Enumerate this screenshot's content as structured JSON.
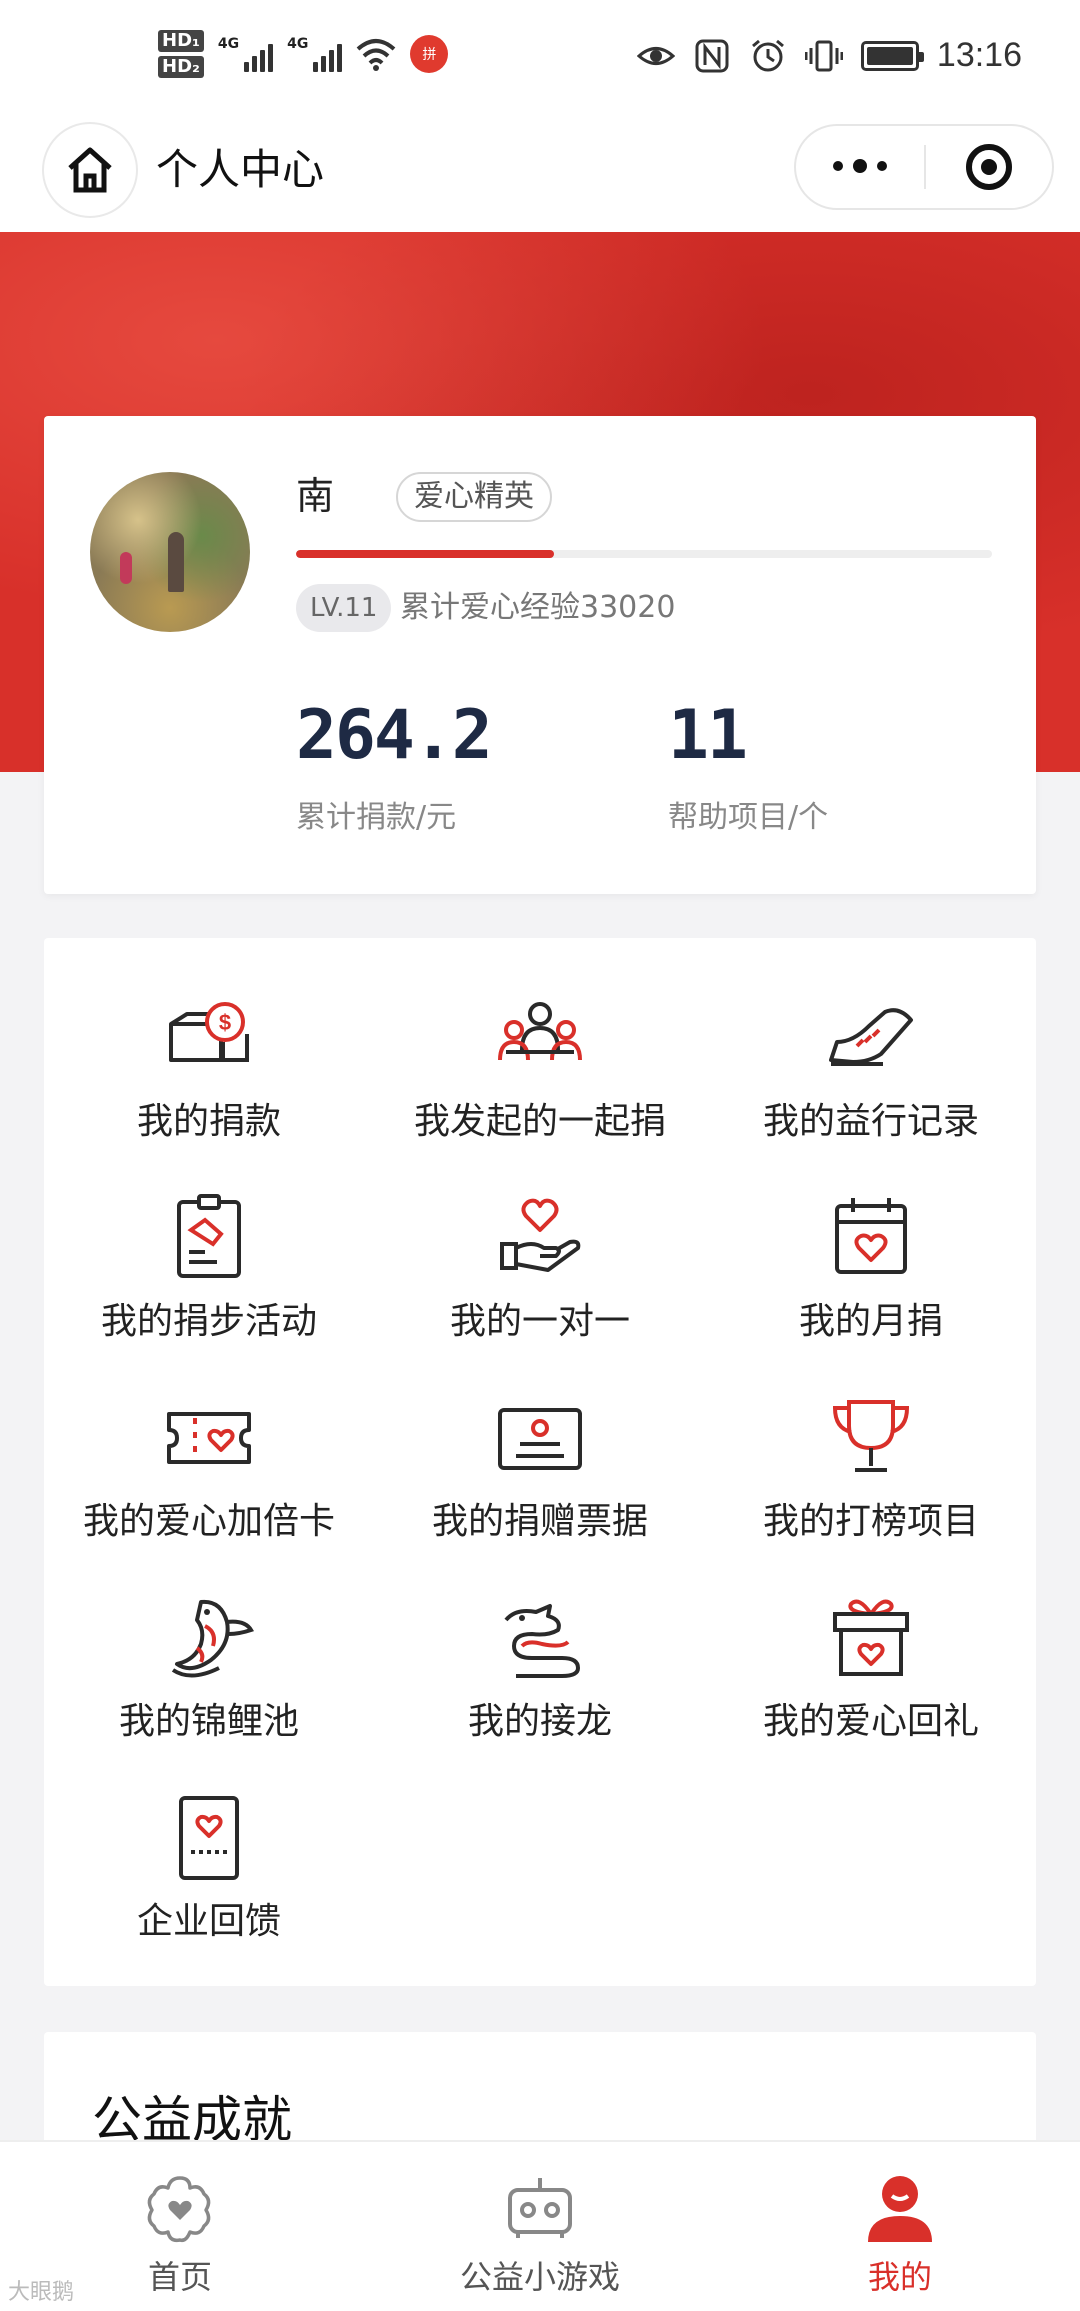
{
  "status_bar": {
    "hd1": "HD₁",
    "hd2": "HD₂",
    "net1": "4G",
    "net2": "4G",
    "time": "13:16",
    "app_dot": "拼"
  },
  "nav": {
    "title": "个人中心"
  },
  "profile": {
    "username": "南",
    "badge": "爱心精英",
    "level": "LV.11",
    "experience": "累计爱心经验33020",
    "level_progress": 0.37,
    "donation_total": "264.2",
    "donation_label": "累计捐款/元",
    "projects_count": "11",
    "projects_label": "帮助项目/个"
  },
  "menu": [
    {
      "label": "我的捐款",
      "icon": "donation-box-icon"
    },
    {
      "label": "我发起的一起捐",
      "icon": "group-people-icon"
    },
    {
      "label": "我的益行记录",
      "icon": "sneaker-icon"
    },
    {
      "label": "我的捐步活动",
      "icon": "clipboard-shoe-icon"
    },
    {
      "label": "我的一对一",
      "icon": "hand-heart-icon"
    },
    {
      "label": "我的月捐",
      "icon": "calendar-heart-icon"
    },
    {
      "label": "我的爱心加倍卡",
      "icon": "ticket-heart-icon"
    },
    {
      "label": "我的捐赠票据",
      "icon": "certificate-icon"
    },
    {
      "label": "我的打榜项目",
      "icon": "trophy-icon"
    },
    {
      "label": "我的锦鲤池",
      "icon": "koi-fish-icon"
    },
    {
      "label": "我的接龙",
      "icon": "dragon-icon"
    },
    {
      "label": "我的爱心回礼",
      "icon": "gift-box-icon"
    },
    {
      "label": "企业回馈",
      "icon": "card-heart-icon"
    }
  ],
  "achievements": {
    "title": "公益成就"
  },
  "tabbar": {
    "tabs": [
      {
        "label": "首页",
        "icon": "flower-heart-icon",
        "active": false
      },
      {
        "label": "公益小游戏",
        "icon": "game-controller-icon",
        "active": false
      },
      {
        "label": "我的",
        "icon": "user-icon",
        "active": true
      }
    ]
  },
  "watermark": "大眼鹅",
  "colors": {
    "accent": "#d9302a",
    "navy": "#1e2a44",
    "icon_dark": "#2a2a2a"
  }
}
